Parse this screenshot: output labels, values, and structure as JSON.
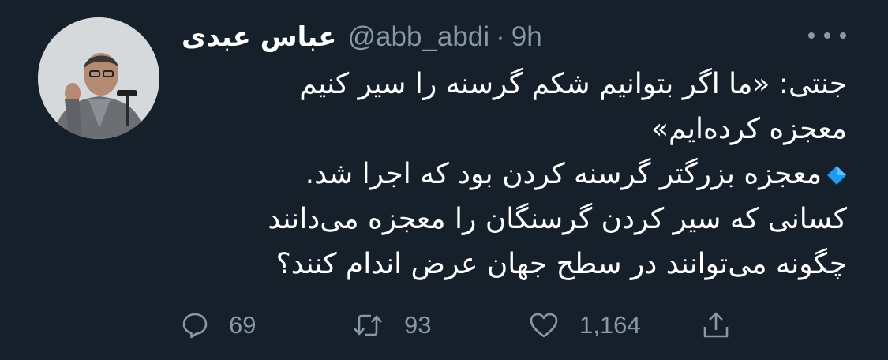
{
  "tweet": {
    "author": {
      "display_name": "عباس عبدی",
      "handle": "@abb_abdi",
      "separator": "·",
      "time": "9h"
    },
    "text_lines": [
      "جنتی: «ما اگر بتوانیم شکم گرسنه را سیر کنیم",
      "معجزه کرده‌ایم»",
      "معجزه بزرگتر گرسنه کردن بود که اجرا شد.",
      "کسانی که سیر کردن گرسنگان را معجزه می‌دانند",
      "چگونه می‌توانند در سطح جهان عرض اندام کنند؟"
    ],
    "bullet_icon": "small-blue-diamond-icon",
    "actions": {
      "reply_count": "69",
      "retweet_count": "93",
      "like_count": "1,164"
    }
  },
  "colors": {
    "background": "#15202b",
    "text": "#ffffff",
    "secondary": "#8899a6",
    "diamond": "#1d9bf0"
  }
}
